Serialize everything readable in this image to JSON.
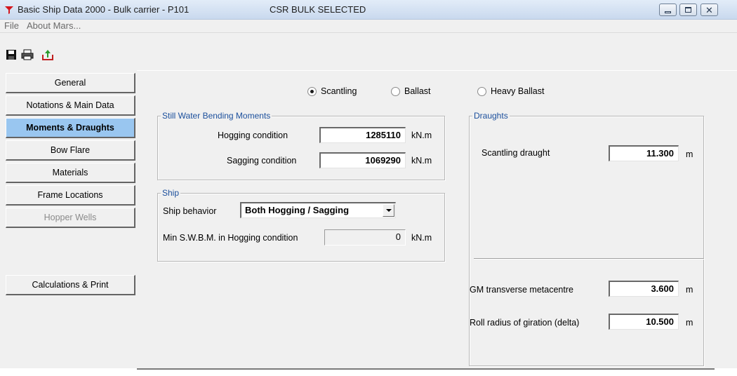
{
  "window": {
    "title": "Basic Ship Data 2000 - Bulk carrier - P101",
    "status": "CSR BULK SELECTED"
  },
  "menu": {
    "file": "File",
    "about": "About Mars..."
  },
  "toolbar": {
    "icons": [
      "save-icon",
      "print-icon",
      "export-icon"
    ]
  },
  "nav": {
    "general": "General",
    "notations": "Notations & Main Data",
    "moments": "Moments & Draughts",
    "bow_flare": "Bow Flare",
    "materials": "Materials",
    "frame_locations": "Frame Locations",
    "hopper_wells": "Hopper Wells",
    "calculations": "Calculations & Print"
  },
  "loading": {
    "scantling": "Scantling",
    "ballast": "Ballast",
    "heavy_ballast": "Heavy Ballast",
    "selected": "Scantling"
  },
  "swbm": {
    "legend": "Still Water Bending Moments",
    "hogging_label": "Hogging condition",
    "hogging_value": "1285110",
    "sagging_label": "Sagging  condition",
    "sagging_value": "1069290",
    "unit": "kN.m"
  },
  "ship": {
    "legend": "Ship",
    "behavior_label": "Ship behavior",
    "behavior_value": "Both Hogging / Sagging",
    "min_label": "Min S.W.B.M. in Hogging condition",
    "min_value": "0",
    "unit": "kN.m"
  },
  "draughts": {
    "legend": "Draughts",
    "scantling_label": "Scantling draught",
    "scantling_value": "11.300",
    "gm_label": "GM transverse metacentre",
    "gm_value": "3.600",
    "roll_label": "Roll radius of giration (delta)",
    "roll_value": "10.500",
    "unit": "m"
  },
  "colors": {
    "active_nav": "#99c6f0",
    "legend_text": "#1b4f9c",
    "app_icon": "#d4141b"
  }
}
